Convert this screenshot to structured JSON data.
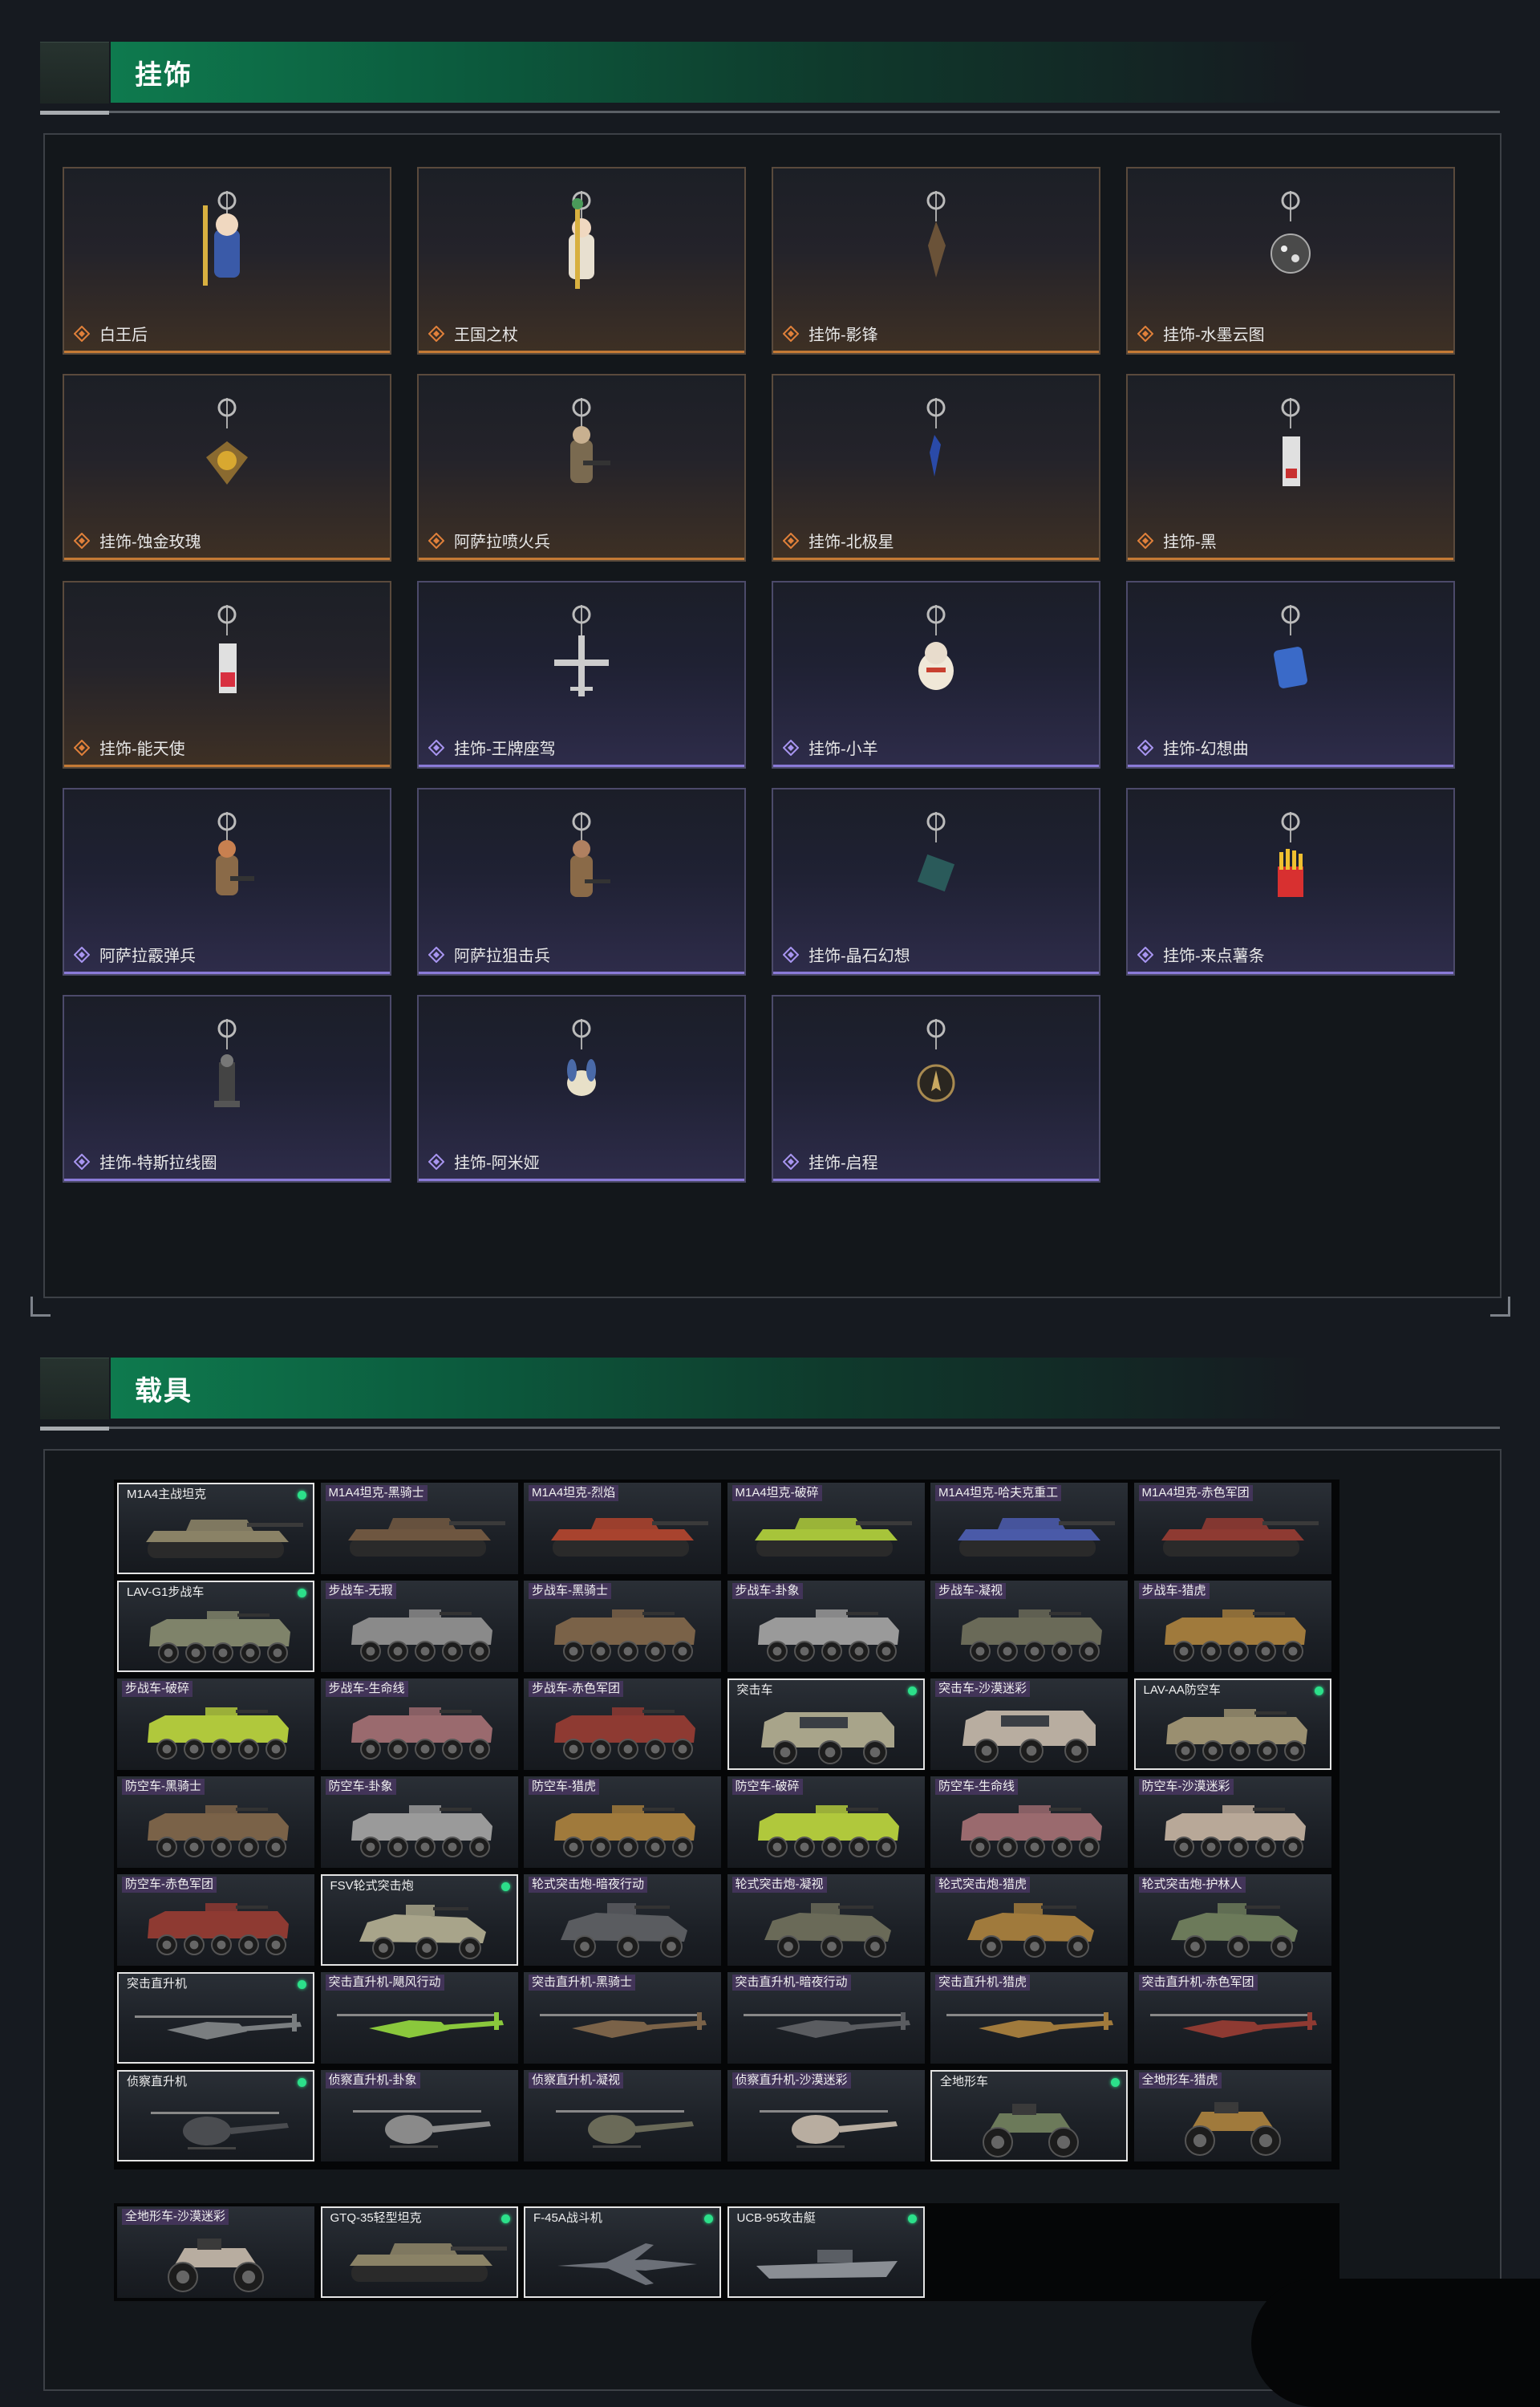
{
  "sections": {
    "pendants_title": "挂饰",
    "vehicles_title": "载具"
  },
  "colors": {
    "accent_green": "#0e7a4e",
    "gold_rarity": "#c47a35",
    "purple_rarity": "#8a7ad8",
    "owned_dot": "#2ce08a"
  },
  "pendants": [
    {
      "name": "白王后",
      "rarity": "gold",
      "icon": "queen-figure-icon"
    },
    {
      "name": "王国之杖",
      "rarity": "gold",
      "icon": "scepter-figure-icon"
    },
    {
      "name": "挂饰-影锋",
      "rarity": "gold",
      "icon": "blade-charm-icon"
    },
    {
      "name": "挂饰-水墨云图",
      "rarity": "gold",
      "icon": "ink-ball-charm-icon"
    },
    {
      "name": "挂饰-蚀金玫瑰",
      "rarity": "gold",
      "icon": "gold-rose-charm-icon"
    },
    {
      "name": "阿萨拉喷火兵",
      "rarity": "gold",
      "icon": "flamethrower-soldier-icon"
    },
    {
      "name": "挂饰-北极星",
      "rarity": "gold",
      "icon": "polaris-charm-icon"
    },
    {
      "name": "挂饰-黑",
      "rarity": "gold",
      "icon": "black-card-charm-icon"
    },
    {
      "name": "挂饰-能天使",
      "rarity": "gold",
      "icon": "angel-card-charm-icon"
    },
    {
      "name": "挂饰-王牌座驾",
      "rarity": "purple",
      "icon": "jet-charm-icon"
    },
    {
      "name": "挂饰-小羊",
      "rarity": "purple",
      "icon": "sheep-charm-icon"
    },
    {
      "name": "挂饰-幻想曲",
      "rarity": "purple",
      "icon": "crystal-charm-icon"
    },
    {
      "name": "阿萨拉霰弹兵",
      "rarity": "purple",
      "icon": "shotgun-soldier-icon"
    },
    {
      "name": "阿萨拉狙击兵",
      "rarity": "purple",
      "icon": "sniper-soldier-icon"
    },
    {
      "name": "挂饰-晶石幻想",
      "rarity": "purple",
      "icon": "gem-cube-charm-icon"
    },
    {
      "name": "挂饰-来点薯条",
      "rarity": "purple",
      "icon": "fries-charm-icon"
    },
    {
      "name": "挂饰-特斯拉线圈",
      "rarity": "purple",
      "icon": "tesla-coil-charm-icon"
    },
    {
      "name": "挂饰-阿米娅",
      "rarity": "purple",
      "icon": "amiya-charm-icon"
    },
    {
      "name": "挂饰-启程",
      "rarity": "purple",
      "icon": "compass-charm-icon"
    }
  ],
  "vehicles": [
    {
      "name": "M1A4主战坦克",
      "kind": "tank",
      "base": true,
      "color": "#8a8266"
    },
    {
      "name": "M1A4坦克-黑骑士",
      "kind": "tank",
      "base": false,
      "color": "#6e5640"
    },
    {
      "name": "M1A4坦克-烈焰",
      "kind": "tank",
      "base": false,
      "color": "#a8432e"
    },
    {
      "name": "M1A4坦克-破碎",
      "kind": "tank",
      "base": false,
      "color": "#a7c43a"
    },
    {
      "name": "M1A4坦克-哈夫克重工",
      "kind": "tank",
      "base": false,
      "color": "#4a5aa8"
    },
    {
      "name": "M1A4坦克-赤色军团",
      "kind": "tank",
      "base": false,
      "color": "#8e3a32"
    },
    {
      "name": "LAV-G1步战车",
      "kind": "ifv",
      "base": true,
      "color": "#7f836a"
    },
    {
      "name": "步战车-无瑕",
      "kind": "ifv",
      "base": false,
      "color": "#8a8a8a"
    },
    {
      "name": "步战车-黑骑士",
      "kind": "ifv",
      "base": false,
      "color": "#7a6248"
    },
    {
      "name": "步战车-卦象",
      "kind": "ifv",
      "base": false,
      "color": "#9a9a9a"
    },
    {
      "name": "步战车-凝视",
      "kind": "ifv",
      "base": false,
      "color": "#6a6a58"
    },
    {
      "name": "步战车-猎虎",
      "kind": "ifv",
      "base": false,
      "color": "#a07a3c"
    },
    {
      "name": "步战车-破碎",
      "kind": "ifv",
      "base": false,
      "color": "#b0c83c"
    },
    {
      "name": "步战车-生命线",
      "kind": "ifv",
      "base": false,
      "color": "#9a6a6e"
    },
    {
      "name": "步战车-赤色军团",
      "kind": "ifv",
      "base": false,
      "color": "#8e3a32"
    },
    {
      "name": "突击车",
      "kind": "assault",
      "base": true,
      "color": "#a8a48a"
    },
    {
      "name": "突击车-沙漠迷彩",
      "kind": "assault",
      "base": false,
      "color": "#b8ada0"
    },
    {
      "name": "LAV-AA防空车",
      "kind": "ifv",
      "base": true,
      "color": "#9a8f70"
    },
    {
      "name": "防空车-黑骑士",
      "kind": "ifv",
      "base": false,
      "color": "#7a6248"
    },
    {
      "name": "防空车-卦象",
      "kind": "ifv",
      "base": false,
      "color": "#9a9a9a"
    },
    {
      "name": "防空车-猎虎",
      "kind": "ifv",
      "base": false,
      "color": "#a07a3c"
    },
    {
      "name": "防空车-破碎",
      "kind": "ifv",
      "base": false,
      "color": "#b0c83c"
    },
    {
      "name": "防空车-生命线",
      "kind": "ifv",
      "base": false,
      "color": "#9a6a6e"
    },
    {
      "name": "防空车-沙漠迷彩",
      "kind": "ifv",
      "base": false,
      "color": "#b8a898"
    },
    {
      "name": "防空车-赤色军团",
      "kind": "ifv",
      "base": false,
      "color": "#8e3a32"
    },
    {
      "name": "FSV轮式突击炮",
      "kind": "buggy",
      "base": true,
      "color": "#a8a48a"
    },
    {
      "name": "轮式突击炮-暗夜行动",
      "kind": "buggy",
      "base": false,
      "color": "#5a5c60"
    },
    {
      "name": "轮式突击炮-凝视",
      "kind": "buggy",
      "base": false,
      "color": "#6a6a58"
    },
    {
      "name": "轮式突击炮-猎虎",
      "kind": "buggy",
      "base": false,
      "color": "#a07a3c"
    },
    {
      "name": "轮式突击炮-护林人",
      "kind": "buggy",
      "base": false,
      "color": "#6c7a5a"
    },
    {
      "name": "突击直升机",
      "kind": "heli",
      "base": true,
      "color": "#7a7e80"
    },
    {
      "name": "突击直升机-飓风行动",
      "kind": "heli",
      "base": false,
      "color": "#8ac83c"
    },
    {
      "name": "突击直升机-黑骑士",
      "kind": "heli",
      "base": false,
      "color": "#7a6248"
    },
    {
      "name": "突击直升机-暗夜行动",
      "kind": "heli",
      "base": false,
      "color": "#5a5c60"
    },
    {
      "name": "突击直升机-猎虎",
      "kind": "heli",
      "base": false,
      "color": "#a07a3c"
    },
    {
      "name": "突击直升机-赤色军团",
      "kind": "heli",
      "base": false,
      "color": "#8e3a32"
    },
    {
      "name": "侦察直升机",
      "kind": "scout",
      "base": true,
      "color": "#4a4c50"
    },
    {
      "name": "侦察直升机-卦象",
      "kind": "scout",
      "base": false,
      "color": "#8a8a8a"
    },
    {
      "name": "侦察直升机-凝视",
      "kind": "scout",
      "base": false,
      "color": "#6a6a58"
    },
    {
      "name": "侦察直升机-沙漠迷彩",
      "kind": "scout",
      "base": false,
      "color": "#b8ada0"
    },
    {
      "name": "全地形车",
      "kind": "atv",
      "base": true,
      "color": "#6c7a5a"
    },
    {
      "name": "全地形车-猎虎",
      "kind": "atv",
      "base": false,
      "color": "#a07a3c"
    }
  ],
  "vehicles_extra": [
    {
      "name": "全地形车-沙漠迷彩",
      "kind": "atv",
      "base": false,
      "color": "#b8ada0"
    },
    {
      "name": "GTQ-35轻型坦克",
      "kind": "tank",
      "base": true,
      "color": "#8a8266"
    },
    {
      "name": "F-45A战斗机",
      "kind": "jet",
      "base": true,
      "color": "#6c7078"
    },
    {
      "name": "UCB-95攻击艇",
      "kind": "boat",
      "base": true,
      "color": "#8a8e94"
    }
  ]
}
